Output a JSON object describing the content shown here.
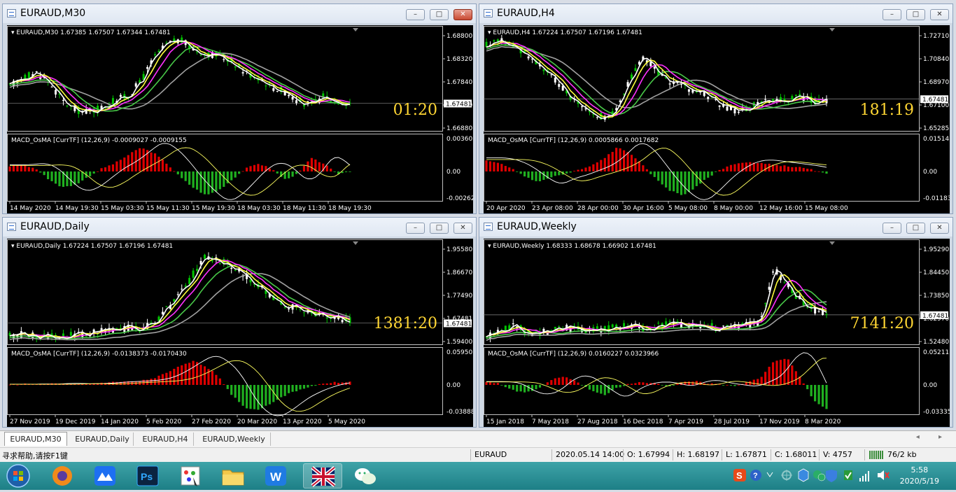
{
  "windows": [
    {
      "id": "m30",
      "title": "EURAUD,M30",
      "close_active": true,
      "info": "EURAUD,M30  1.67385 1.67507 1.67344 1.67481",
      "countdown": "01:20",
      "price_ticks": [
        "1.68800",
        "1.68320",
        "1.67840",
        "1.67360",
        "1.66880"
      ],
      "price_tag": "1.67481",
      "macd_label": "MACD_OsMA [CurrTF] (12,26,9) -0.0009027 -0.0009155",
      "macd_ticks": [
        "0.0036051",
        "0.00",
        "-0.002624"
      ],
      "time_labels": [
        "14 May 2020",
        "14 May 19:30",
        "15 May 03:30",
        "15 May 11:30",
        "15 May 19:30",
        "18 May 03:30",
        "18 May 11:30",
        "18 May 19:30"
      ]
    },
    {
      "id": "h4",
      "title": "EURAUD,H4",
      "close_active": false,
      "info": "EURAUD,H4  1.67224 1.67507 1.67196 1.67481",
      "countdown": "181:19",
      "price_ticks": [
        "1.72710",
        "1.70840",
        "1.68970",
        "1.67100",
        "1.65285"
      ],
      "price_tag": "1.67481",
      "macd_label": "MACD_OsMA [CurrTF] (12,26,9) 0.0005866 0.0017682",
      "macd_ticks": [
        "0.0151478",
        "0.00",
        "-0.011835"
      ],
      "time_labels": [
        "20 Apr 2020",
        "23 Apr 08:00",
        "28 Apr 00:00",
        "30 Apr 16:00",
        "5 May 08:00",
        "8 May 00:00",
        "12 May 16:00",
        "15 May 08:00"
      ]
    },
    {
      "id": "daily",
      "title": "EURAUD,Daily",
      "close_active": false,
      "info": "EURAUD,Daily  1.67224 1.67507 1.67196 1.67481",
      "countdown": "1381:20",
      "price_ticks": [
        "1.95580",
        "1.86670",
        "1.77490",
        "1.67481",
        "1.59400"
      ],
      "price_tag": "1.67481",
      "macd_label": "MACD_OsMA [CurrTF] (12,26,9) -0.0138373 -0.0170430",
      "macd_ticks": [
        "0.0595038",
        "0.00",
        "-0.038889"
      ],
      "time_labels": [
        "27 Nov 2019",
        "19 Dec 2019",
        "14 Jan 2020",
        "5 Feb 2020",
        "27 Feb 2020",
        "20 Mar 2020",
        "13 Apr 2020",
        "5 May 2020"
      ]
    },
    {
      "id": "weekly",
      "title": "EURAUD,Weekly",
      "close_active": false,
      "info": "EURAUD,Weekly  1.68333 1.68678 1.66902 1.67481",
      "countdown": "7141:20",
      "price_ticks": [
        "1.95290",
        "1.84450",
        "1.73850",
        "1.62970",
        "1.52480"
      ],
      "price_tag": "1.67481",
      "macd_label": "MACD_OsMA [CurrTF] (12,26,9) 0.0160227 0.0323966",
      "macd_ticks": [
        "0.0521137",
        "0.00",
        "-0.033358"
      ],
      "time_labels": [
        "15 Jan 2018",
        "7 May 2018",
        "27 Aug 2018",
        "16 Dec 2018",
        "7 Apr 2019",
        "28 Jul 2019",
        "17 Nov 2019",
        "8 Mar 2020"
      ]
    }
  ],
  "window_buttons": {
    "minimize": "–",
    "maximize": "□",
    "close": "✕"
  },
  "tabs": [
    "EURAUD,M30",
    "EURAUD,Daily",
    "EURAUD,H4",
    "EURAUD,Weekly"
  ],
  "tab_arrows": "◂ ▸",
  "status": {
    "help": "寻求帮助,请按F1键",
    "symbol": "EURAUD",
    "datetime": "2020.05.14 14:00",
    "open": "O: 1.67994",
    "high": "H: 1.68197",
    "low": "L: 1.67871",
    "close": "C: 1.68011",
    "volume": "V: 4757",
    "traffic": "76/2 kb"
  },
  "taskbar": {
    "apps": [
      "start-orb",
      "firefox",
      "lanhu",
      "photoshop",
      "paint",
      "explorer",
      "wps",
      "uk-flag",
      "wechat"
    ],
    "time": "5:58",
    "date": "2020/5/19"
  },
  "colors": {
    "bull": "#ffffff",
    "bear": "#00c400",
    "ma_fast": "#ffffff",
    "ma_mid": "#ffff3c",
    "ma_slow": "#ff30ff",
    "ma_green": "#48c848",
    "ma_gray": "#a0a0a0",
    "osma_pos": "#e00000",
    "osma_neg": "#20b020",
    "countdown": "#ffd633"
  }
}
